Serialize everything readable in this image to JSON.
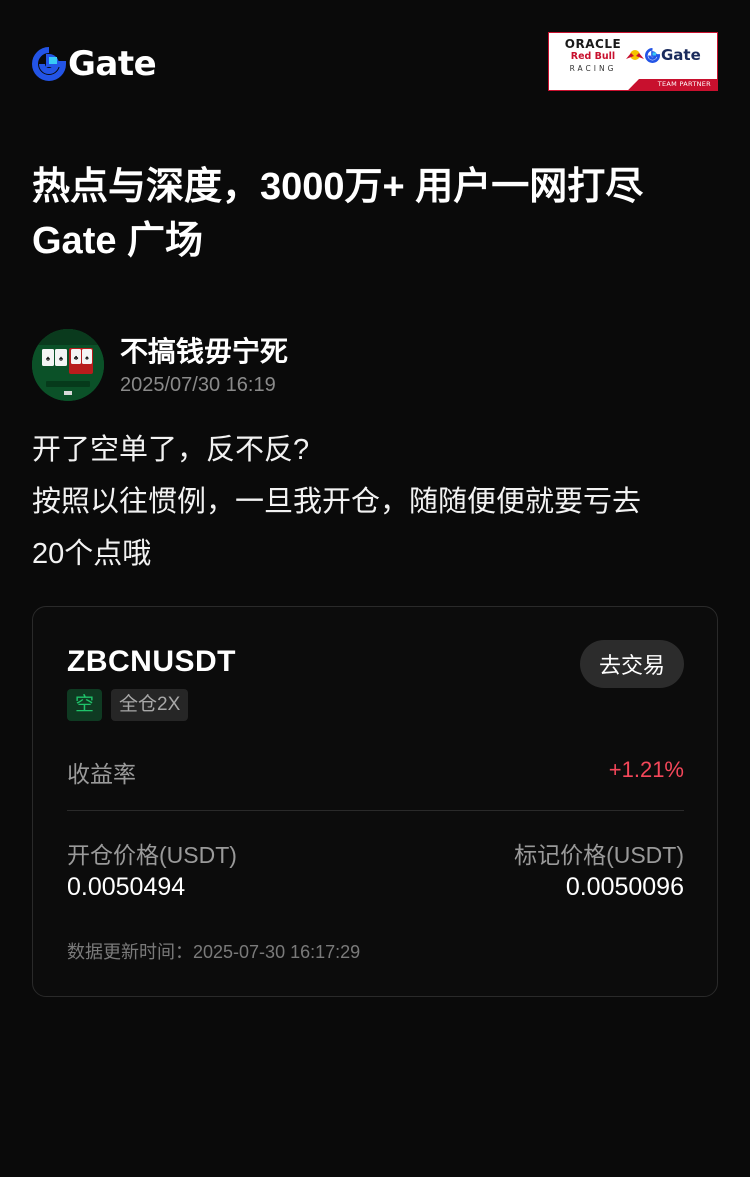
{
  "brand": {
    "name": "Gate",
    "accent": "#2354e6",
    "partner": {
      "oracle": "ORACLE",
      "red_bull": "Red Bull",
      "racing": "RACING",
      "gate": "Gate",
      "footer": "TEAM PARTNER",
      "border_color": "#c8102e"
    }
  },
  "headline": {
    "line1": "热点与深度，3000万+ 用户一网打尽",
    "line2": "Gate 广场"
  },
  "post": {
    "author": "不搞钱毋宁死",
    "time": "2025/07/30 16:19",
    "lines": [
      "开了空单了，反不反?",
      "按照以往惯例，一旦我开仓，随随便便就要亏去",
      "20个点哦"
    ]
  },
  "position_card": {
    "symbol": "ZBCNUSDT",
    "trade_button": "去交易",
    "side_tag": "空",
    "margin_tag": "全仓2X",
    "yield_label": "收益率",
    "yield_value": "+1.21%",
    "entry_price_label": "开仓价格(USDT)",
    "entry_price": "0.0050494",
    "mark_price_label": "标记价格(USDT)",
    "mark_price": "0.0050096",
    "updated_label": "数据更新时间：",
    "updated_time": "2025-07-30 16:17:29",
    "colors": {
      "profit": "#f5475a",
      "short": "#1fc36a"
    }
  }
}
